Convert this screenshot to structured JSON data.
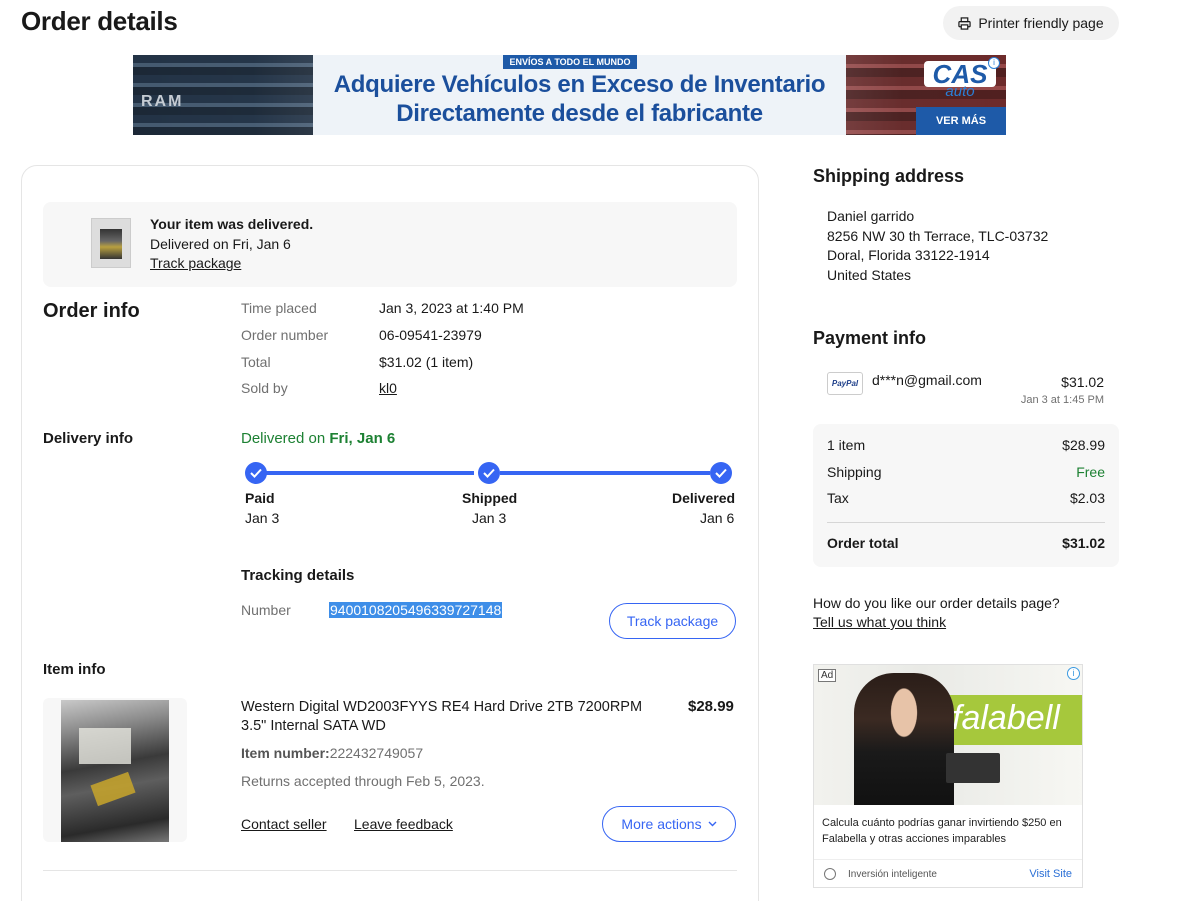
{
  "page": {
    "title": "Order details",
    "printer_label": "Printer friendly page"
  },
  "banner": {
    "strip": "ENVÍOS A TODO EL MUNDO",
    "line1": "Adquiere Vehículos en Exceso de Inventario",
    "line2": "Directamente desde el fabricante",
    "logo_top": "CAS",
    "logo_bottom": "auto",
    "cta": "VER MÁS",
    "truck_text": "RAM"
  },
  "status": {
    "title": "Your item was delivered.",
    "date": "Delivered on Fri, Jan 6",
    "track_link": "Track package"
  },
  "order_info": {
    "heading": "Order info",
    "rows": [
      {
        "label": "Time placed",
        "value": "Jan 3, 2023 at 1:40 PM"
      },
      {
        "label": "Order number",
        "value": "06-09541-23979"
      },
      {
        "label": "Total",
        "value": "$31.02 (1 item)"
      },
      {
        "label": "Sold by",
        "value": "kl0"
      }
    ]
  },
  "delivery": {
    "heading": "Delivery info",
    "status_prefix": "Delivered on ",
    "status_date": "Fri, Jan 6",
    "steps": [
      {
        "name": "Paid",
        "date": "Jan 3"
      },
      {
        "name": "Shipped",
        "date": "Jan 3"
      },
      {
        "name": "Delivered",
        "date": "Jan 6"
      }
    ],
    "tracking_heading": "Tracking details",
    "number_label": "Number",
    "tracking_number": "9400108205496339727148",
    "track_button": "Track package"
  },
  "item": {
    "heading": "Item info",
    "title": "Western Digital WD2003FYYS RE4 Hard Drive 2TB 7200RPM 3.5\" Internal SATA WD",
    "price": "$28.99",
    "number_label": "Item number:",
    "number": "222432749057",
    "returns": "Returns accepted through Feb 5, 2023.",
    "contact": "Contact seller",
    "feedback": "Leave feedback",
    "more_actions": "More actions"
  },
  "shipping": {
    "heading": "Shipping address",
    "lines": [
      "Daniel garrido",
      "8256 NW 30 th Terrace, TLC-03732",
      "Doral, Florida 33122-1914",
      "United States"
    ]
  },
  "payment": {
    "heading": "Payment info",
    "method": "PayPal",
    "email": "d***n@gmail.com",
    "amount": "$31.02",
    "date": "Jan 3 at 1:45 PM",
    "summary": [
      {
        "label": "1 item",
        "value": "$28.99"
      },
      {
        "label": "Shipping",
        "value": "Free"
      },
      {
        "label": "Tax",
        "value": "$2.03"
      }
    ],
    "total_label": "Order total",
    "total_value": "$31.02"
  },
  "feedback": {
    "question": "How do you like our order details page?",
    "link": "Tell us what you think"
  },
  "ad": {
    "tag": "Ad",
    "brand": "falabell",
    "text": "Calcula cuánto podrías ganar invirtiendo $250 en Falabella y otras acciones imparables",
    "source": "Inversión inteligente",
    "visit": "Visit Site"
  },
  "colors": {
    "accent": "#3665f3",
    "delivered_green": "#1d8133"
  }
}
